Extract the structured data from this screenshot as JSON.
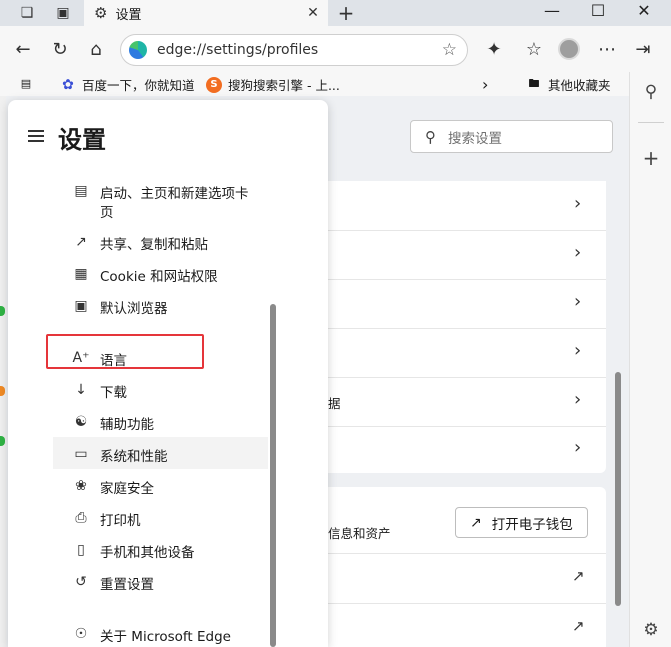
{
  "window": {
    "tab_title": "设置",
    "new_tab_label": "+",
    "controls": [
      "minimize",
      "maximize",
      "close"
    ]
  },
  "nav": {
    "url_scheme": "edge://",
    "url_path": "settings/profiles"
  },
  "favorites": {
    "items": [
      {
        "label": "百度一下，你就知道",
        "icon": "paw-icon"
      },
      {
        "label": "搜狗搜索引擎 - 上...",
        "icon": "sogou-icon"
      }
    ],
    "other_favorites": "其他收藏夹"
  },
  "settings": {
    "title": "设置",
    "search_placeholder": "搜索设置",
    "menu_items": [
      {
        "label": "启动、主页和新建选项卡",
        "label_line2": "页",
        "icon": "startup-icon"
      },
      {
        "label": "共享、复制和粘贴",
        "icon": "share-icon"
      },
      {
        "label": "Cookie 和网站权限",
        "icon": "cookie-icon"
      },
      {
        "label": "默认浏览器",
        "icon": "default-browser-icon"
      },
      {
        "label": "语言",
        "icon": "language-icon"
      },
      {
        "label": "下载",
        "icon": "download-icon"
      },
      {
        "label": "辅助功能",
        "icon": "accessibility-icon"
      },
      {
        "label": "系统和性能",
        "icon": "laptop-icon",
        "selected": true
      },
      {
        "label": "家庭安全",
        "icon": "family-icon"
      },
      {
        "label": "打印机",
        "icon": "printer-icon"
      },
      {
        "label": "手机和其他设备",
        "icon": "phone-icon"
      },
      {
        "label": "重置设置",
        "icon": "reset-icon"
      },
      {
        "label": "关于 Microsoft Edge",
        "icon": "edge-icon"
      }
    ]
  },
  "main": {
    "partial_data_label": "据",
    "wallet_desc": "信息和资产",
    "wallet_button": "打开电子钱包"
  },
  "colors": {
    "highlight_border": "#e5353a",
    "page_bg": "#eef0f3"
  }
}
